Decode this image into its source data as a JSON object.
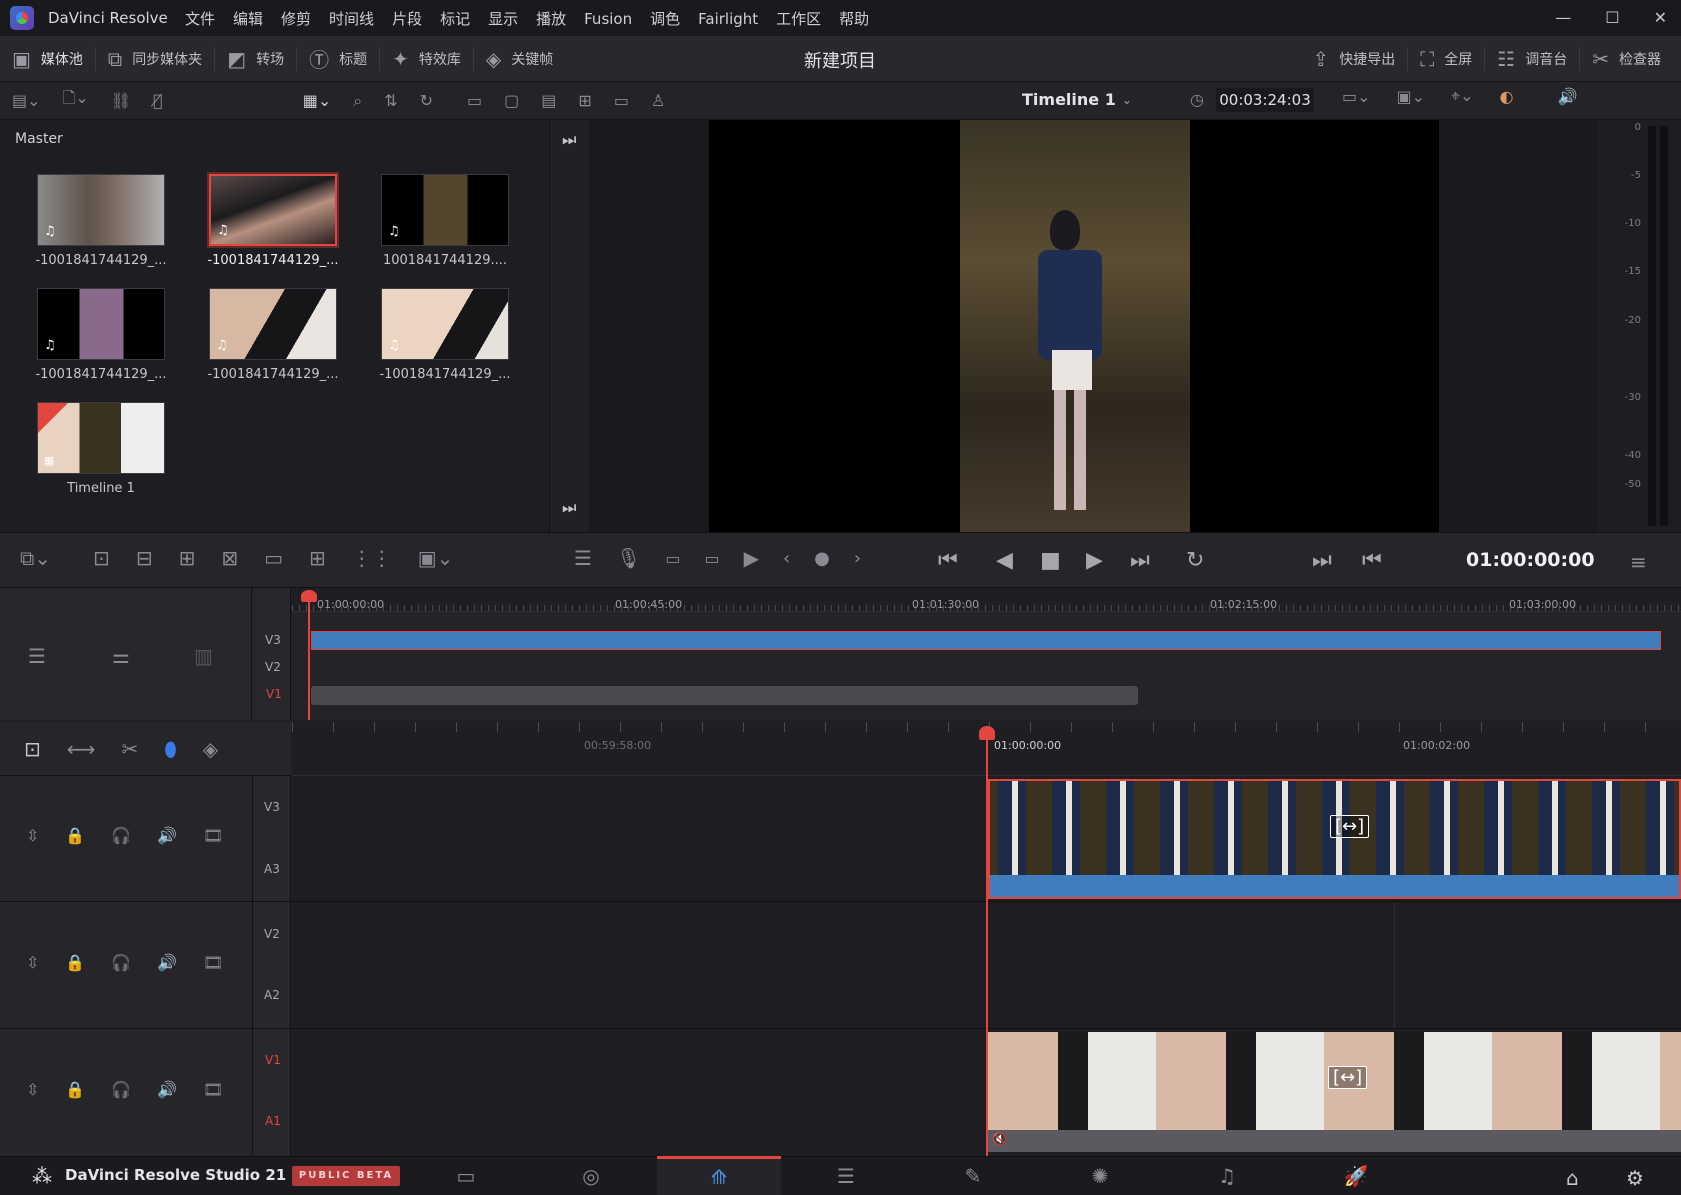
{
  "app": {
    "name": "DaVinci Resolve",
    "menu": [
      "文件",
      "编辑",
      "修剪",
      "时间线",
      "片段",
      "标记",
      "显示",
      "播放",
      "Fusion",
      "调色",
      "Fairlight",
      "工作区",
      "帮助"
    ],
    "window_controls": [
      "—",
      "☐",
      "✕"
    ]
  },
  "toolbar": {
    "left": [
      {
        "label": "媒体池",
        "icon": "media-pool-icon"
      },
      {
        "label": "同步媒体夹",
        "icon": "sync-bin-icon"
      },
      {
        "label": "转场",
        "icon": "transitions-icon"
      },
      {
        "label": "标题",
        "icon": "titles-icon"
      },
      {
        "label": "特效库",
        "icon": "effects-icon"
      },
      {
        "label": "关键帧",
        "icon": "keyframes-icon"
      }
    ],
    "project_title": "新建项目",
    "right": [
      {
        "label": "快捷导出",
        "icon": "quick-export-icon"
      },
      {
        "label": "全屏",
        "icon": "fullscreen-icon"
      },
      {
        "label": "调音台",
        "icon": "mixer-icon"
      },
      {
        "label": "检查器",
        "icon": "inspector-icon"
      }
    ]
  },
  "toolbar2": {
    "timeline_name": "Timeline 1",
    "timecode": "00:03:24:03"
  },
  "media_pool": {
    "bin": "Master",
    "clips": [
      {
        "label": "-1001841744129_...",
        "selected": false,
        "audio": true
      },
      {
        "label": "-1001841744129_...",
        "selected": true,
        "audio": true
      },
      {
        "label": "1001841744129....",
        "selected": false,
        "audio": true
      },
      {
        "label": "-1001841744129_...",
        "selected": false,
        "audio": true
      },
      {
        "label": "-1001841744129_...",
        "selected": false,
        "audio": true
      },
      {
        "label": "-1001841744129_...",
        "selected": false,
        "audio": true
      },
      {
        "label": "Timeline 1",
        "selected": false,
        "audio": false
      }
    ]
  },
  "audio_meter": {
    "labels": [
      "0",
      "-5",
      "-10",
      "-15",
      "-20",
      "-30",
      "-40",
      "-50"
    ]
  },
  "transport": {
    "timecode": "01:00:00:00"
  },
  "overview": {
    "ruler": [
      "01:00:00:00",
      "01:00:45:00",
      "01:01:30:00",
      "01:02:15:00",
      "01:03:00:00"
    ],
    "tracks": [
      "V3",
      "V2",
      "V1"
    ]
  },
  "timeline": {
    "ruler": [
      "00:59:58:00",
      "01:00:00:00",
      "01:00:02:00"
    ],
    "tracks": [
      {
        "video": "V3",
        "audio": "A3"
      },
      {
        "video": "V2",
        "audio": "A2"
      },
      {
        "video": "V1",
        "audio": "A1"
      }
    ]
  },
  "bottom": {
    "product": "DaVinci Resolve Studio 21",
    "badge": "PUBLIC BETA",
    "pages": [
      "media-page-icon",
      "cut-page-icon",
      "edit-page-icon",
      "fusion-page-icon",
      "color-page-icon",
      "fairlight-page-icon",
      "deliver-page-icon"
    ],
    "active_page": 2
  },
  "colors": {
    "accent_red": "#e2463f",
    "clip_blue": "#3f7dbd",
    "active_page_blue": "#4f8fe0"
  }
}
